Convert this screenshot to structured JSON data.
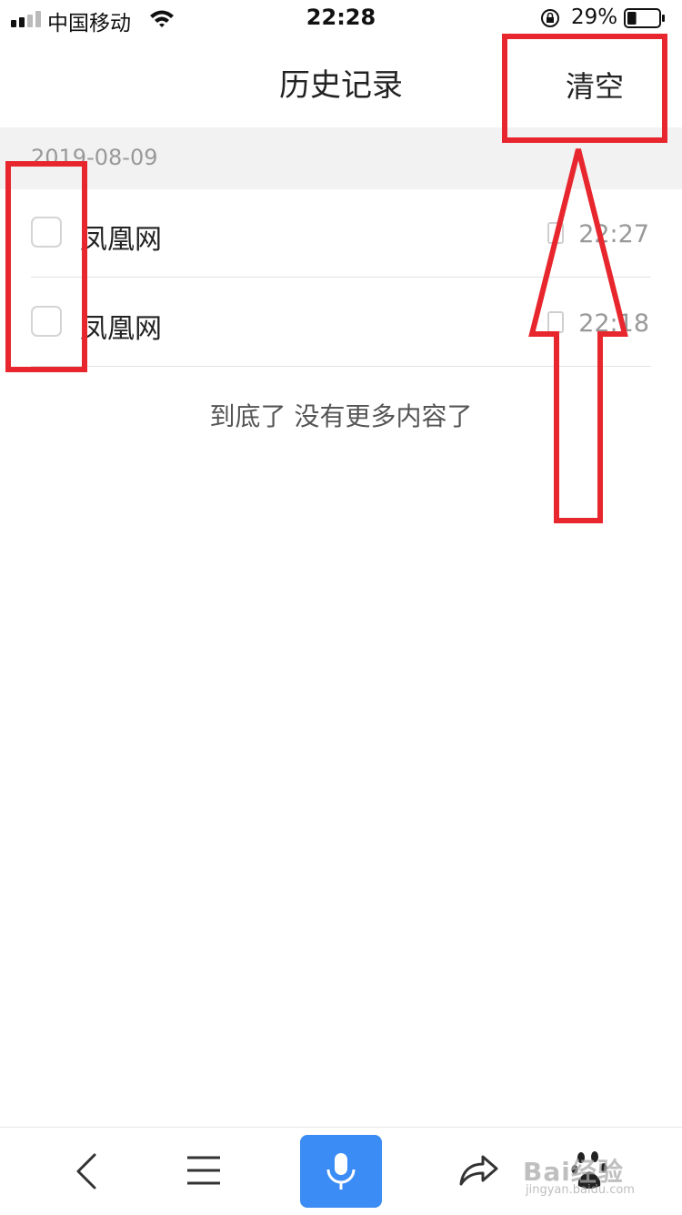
{
  "status_bar": {
    "carrier": "中国移动",
    "time": "22:28",
    "battery_percent": "29%",
    "battery_level": 0.29,
    "signal_bars_filled": 2,
    "signal_bars_total": 4,
    "icons": [
      "signal-icon",
      "wifi-icon",
      "orientation-lock-icon",
      "battery-icon"
    ]
  },
  "nav": {
    "title": "历史记录",
    "clear_label": "清空"
  },
  "history": {
    "date": "2019-08-09",
    "items": [
      {
        "title": "凤凰网",
        "time": "22:27",
        "checked": false
      },
      {
        "title": "凤凰网",
        "time": "22:18",
        "checked": false
      }
    ],
    "end_note": "到底了 没有更多内容了"
  },
  "toolbar": {
    "icons": [
      "back-icon",
      "menu-icon",
      "microphone-icon",
      "share-icon",
      "paw-icon"
    ],
    "voice_color": "#3b8cf4"
  },
  "watermark": {
    "main": "Bai经验",
    "sub": "jingyan.baidu.com"
  },
  "colors": {
    "annotation": "#e8262d",
    "section_bg": "#f2f2f2",
    "muted_text": "#999999"
  }
}
